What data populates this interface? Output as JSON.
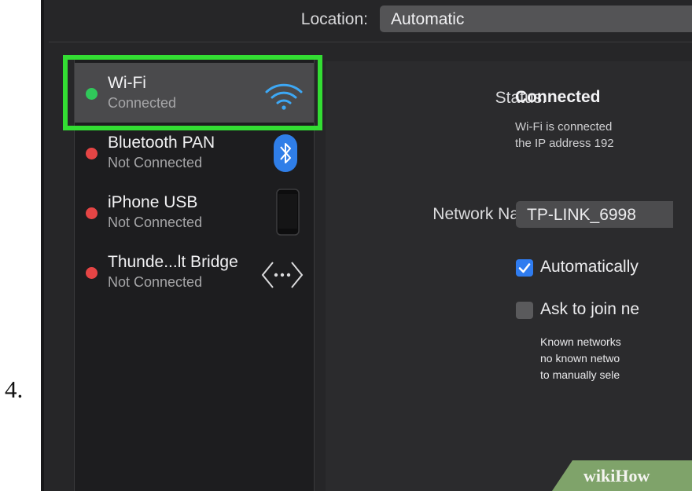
{
  "step_number": "4.",
  "location": {
    "label": "Location:",
    "value": "Automatic"
  },
  "services": [
    {
      "name": "Wi-Fi",
      "status": "Connected",
      "dot_color": "#30c85a",
      "icon": "wifi-icon",
      "selected": true
    },
    {
      "name": "Bluetooth PAN",
      "status": "Not Connected",
      "dot_color": "#e54545",
      "icon": "bluetooth-icon",
      "selected": false
    },
    {
      "name": "iPhone USB",
      "status": "Not Connected",
      "dot_color": "#e54545",
      "icon": "iphone-icon",
      "selected": false
    },
    {
      "name": "Thunde...lt Bridge",
      "status": "Not Connected",
      "dot_color": "#e54545",
      "icon": "thunderbolt-bridge-icon",
      "selected": false
    }
  ],
  "detail": {
    "status_label": "Status:",
    "status_value": "Connected",
    "status_desc_line1": "Wi-Fi is connected",
    "status_desc_line2": "the IP address 192",
    "network_name_label": "Network Name:",
    "network_name_value": "TP-LINK_6998",
    "auto_join_label": "Automatically",
    "auto_join_checked": true,
    "ask_join_label": "Ask to join ne",
    "ask_join_checked": false,
    "info_line1": "Known networks",
    "info_line2": "no known netwo",
    "info_line3": "to manually sele"
  },
  "watermark": {
    "part1": "wiki",
    "part2": "How"
  },
  "colors": {
    "highlight": "#33dd33",
    "checkbox_accent": "#2f7cf0",
    "wifi_blue": "#3da8f5"
  }
}
